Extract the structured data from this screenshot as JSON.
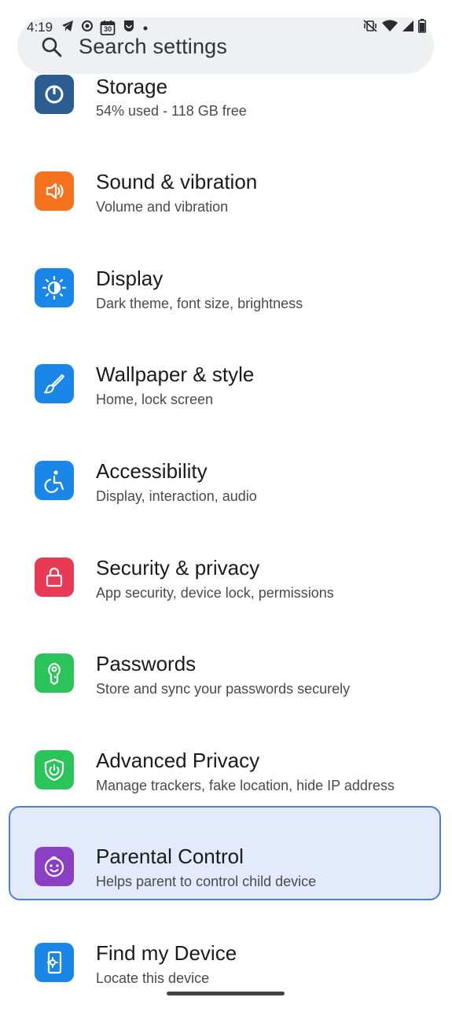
{
  "status_bar": {
    "time": "4:19",
    "calendar_day": "30"
  },
  "search": {
    "placeholder": "Search settings"
  },
  "items": [
    {
      "title": "Storage",
      "subtitle": "54% used - 118 GB free",
      "color": "#2b5d93",
      "icon": "storage-icon"
    },
    {
      "title": "Sound & vibration",
      "subtitle": "Volume and vibration",
      "color": "#f5731f",
      "icon": "speaker-icon"
    },
    {
      "title": "Display",
      "subtitle": "Dark theme, font size, brightness",
      "color": "#1a86e8",
      "icon": "brightness-icon"
    },
    {
      "title": "Wallpaper & style",
      "subtitle": "Home, lock screen",
      "color": "#1a86e8",
      "icon": "brush-icon"
    },
    {
      "title": "Accessibility",
      "subtitle": "Display, interaction, audio",
      "color": "#1a86e8",
      "icon": "accessibility-icon"
    },
    {
      "title": "Security & privacy",
      "subtitle": "App security, device lock, permissions",
      "color": "#e83a55",
      "icon": "lock-icon"
    },
    {
      "title": "Passwords",
      "subtitle": "Store and sync your passwords securely",
      "color": "#2bc45a",
      "icon": "key-icon"
    },
    {
      "title": "Advanced Privacy",
      "subtitle": "Manage trackers, fake location, hide IP address",
      "color": "#2bc45a",
      "icon": "shield-power-icon"
    },
    {
      "title": "Parental Control",
      "subtitle": "Helps parent to control child device",
      "color": "#8b3fc2",
      "icon": "child-face-icon",
      "highlighted": true
    },
    {
      "title": "Find my Device",
      "subtitle": "Locate this device",
      "color": "#1a86e8",
      "icon": "find-device-icon"
    }
  ],
  "colors": {
    "highlight_bg": "#e2eafb",
    "highlight_border": "#4a7fe0",
    "search_bg": "#eef0f3"
  }
}
